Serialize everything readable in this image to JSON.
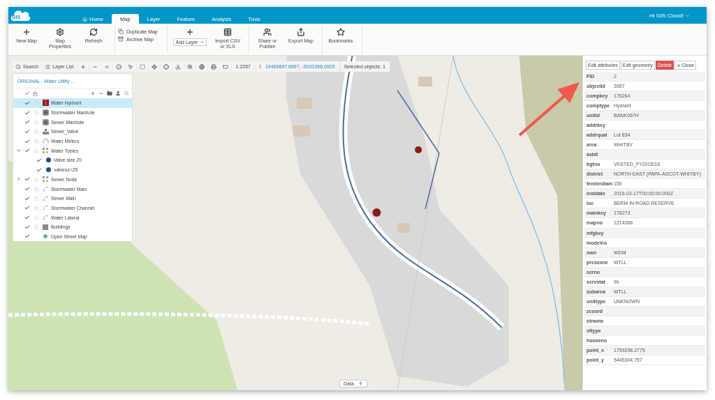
{
  "header": {
    "logo": "GIS",
    "tabs": [
      {
        "label": "Home",
        "selected": false
      },
      {
        "label": "Map",
        "selected": true
      },
      {
        "label": "Layer",
        "selected": false
      },
      {
        "label": "Feature",
        "selected": false
      },
      {
        "label": "Analysis",
        "selected": false
      },
      {
        "label": "Tools",
        "selected": false
      }
    ],
    "user": "Hi GIS Cloud!"
  },
  "ribbon": [
    {
      "items": [
        {
          "kind": "big",
          "label": "New Map"
        },
        {
          "kind": "big",
          "label": "Map Properties"
        },
        {
          "kind": "big",
          "label": "Refresh"
        }
      ]
    },
    {
      "items": [
        {
          "kind": "small",
          "label": "Duplicate Map"
        },
        {
          "kind": "small",
          "label": "Archive Map"
        }
      ]
    },
    {
      "items": [
        {
          "kind": "split",
          "label": "Add Layer"
        },
        {
          "kind": "big",
          "label": "Import CSV or XLS"
        }
      ]
    },
    {
      "items": [
        {
          "kind": "big",
          "label": "Share or Publish"
        },
        {
          "kind": "big",
          "label": "Export Map"
        }
      ]
    },
    {
      "items": [
        {
          "kind": "big",
          "label": "Bookmarks"
        }
      ]
    }
  ],
  "map_toolbar": {
    "search": "Search",
    "layer_list": "Layer List",
    "scale": "1:2257",
    "coordinates": "19469697.6697, -5031066.0925",
    "selection": "Selected objects: 1"
  },
  "layers_panel": {
    "title": "ORIGINAL - Water Utility ...",
    "layers": [
      {
        "name": "Water Hydrant",
        "kind": "hydrant",
        "checked": true,
        "locked": false,
        "selected": true
      },
      {
        "name": "Stormwater Manhole",
        "kind": "manhole",
        "checked": true,
        "locked": false,
        "selected": false
      },
      {
        "name": "Sewer Manhole",
        "kind": "manhole",
        "checked": true,
        "locked": false,
        "selected": false
      },
      {
        "name": "Sewer_Valve",
        "kind": "valve",
        "checked": true,
        "locked": false,
        "selected": false
      },
      {
        "name": "Water Meters",
        "kind": "meter",
        "checked": true,
        "locked": false,
        "selected": false
      },
      {
        "name": "Water Tobies",
        "kind": "theme",
        "checked": true,
        "locked": false,
        "selected": false,
        "expanded": true,
        "children": [
          {
            "name": "Valve size 20",
            "kind": "dot",
            "checked": true,
            "selected": false
          },
          {
            "name": "valvesz=25",
            "kind": "dot",
            "checked": true,
            "selected": false
          }
        ]
      },
      {
        "name": "Sewer Node",
        "kind": "theme",
        "checked": true,
        "locked": false,
        "selected": false,
        "expanded": false
      },
      {
        "name": "Stormwater Main",
        "kind": "line",
        "checked": true,
        "locked": false,
        "selected": false
      },
      {
        "name": "Sewer Main",
        "kind": "line",
        "checked": true,
        "locked": false,
        "selected": false
      },
      {
        "name": "Stormwater Channel",
        "kind": "line",
        "checked": true,
        "locked": false,
        "selected": false
      },
      {
        "name": "Water Lateral",
        "kind": "line",
        "checked": true,
        "locked": false,
        "selected": false
      },
      {
        "name": "Buildings",
        "kind": "polygon",
        "checked": true,
        "locked": false,
        "selected": false
      },
      {
        "name": "Open Street Map",
        "kind": "basemap",
        "checked": true,
        "selected": false
      }
    ]
  },
  "attributes_panel": {
    "buttons": [
      {
        "label": "Edit attributes",
        "kind": "default"
      },
      {
        "label": "Edit geometry",
        "kind": "default"
      },
      {
        "label": "Delete",
        "kind": "danger"
      },
      {
        "label": "Close",
        "kind": "close"
      }
    ],
    "rows": [
      {
        "name": "FID",
        "value": "2"
      },
      {
        "name": "objectid",
        "value": "3957"
      },
      {
        "name": "compkey",
        "value": "176264"
      },
      {
        "name": "comptype",
        "value": "Hydrant"
      },
      {
        "name": "unitid",
        "value": "BANK067H"
      },
      {
        "name": "addrkey"
      },
      {
        "name": "addrqual",
        "value": "Lot 834"
      },
      {
        "name": "area",
        "value": "WHITBY"
      },
      {
        "name": "asblt"
      },
      {
        "name": "bgtno",
        "value": "VESTED_FY2015/16"
      },
      {
        "name": "district",
        "value": "NORTH EAST (PAPA-ASCOT-WHITBY)"
      },
      {
        "name": "feederdiam",
        "value": "150"
      },
      {
        "name": "instdate",
        "value": "2016-03-17T00:00:00.000Z"
      },
      {
        "name": "loc",
        "value": "BERM IN ROAD RESERVE"
      },
      {
        "name": "mainkey",
        "value": "176273"
      },
      {
        "name": "mapno",
        "value": "1214368"
      },
      {
        "name": "mfgkey"
      },
      {
        "name": "modelno"
      },
      {
        "name": "own",
        "value": "WDM"
      },
      {
        "name": "preszone",
        "value": "WTLL"
      },
      {
        "name": "serno"
      },
      {
        "name": "servstat",
        "value": "IN"
      },
      {
        "name": "subarea",
        "value": "WTLL"
      },
      {
        "name": "unittype",
        "value": "UNKNOWN"
      },
      {
        "name": "zcoord"
      },
      {
        "name": "stname"
      },
      {
        "name": "sttype"
      },
      {
        "name": "houseno"
      },
      {
        "name": "point_x",
        "value": "1759298.2775"
      },
      {
        "name": "point_y",
        "value": "5445304.757"
      }
    ]
  },
  "data_tab": {
    "label": "Data"
  }
}
